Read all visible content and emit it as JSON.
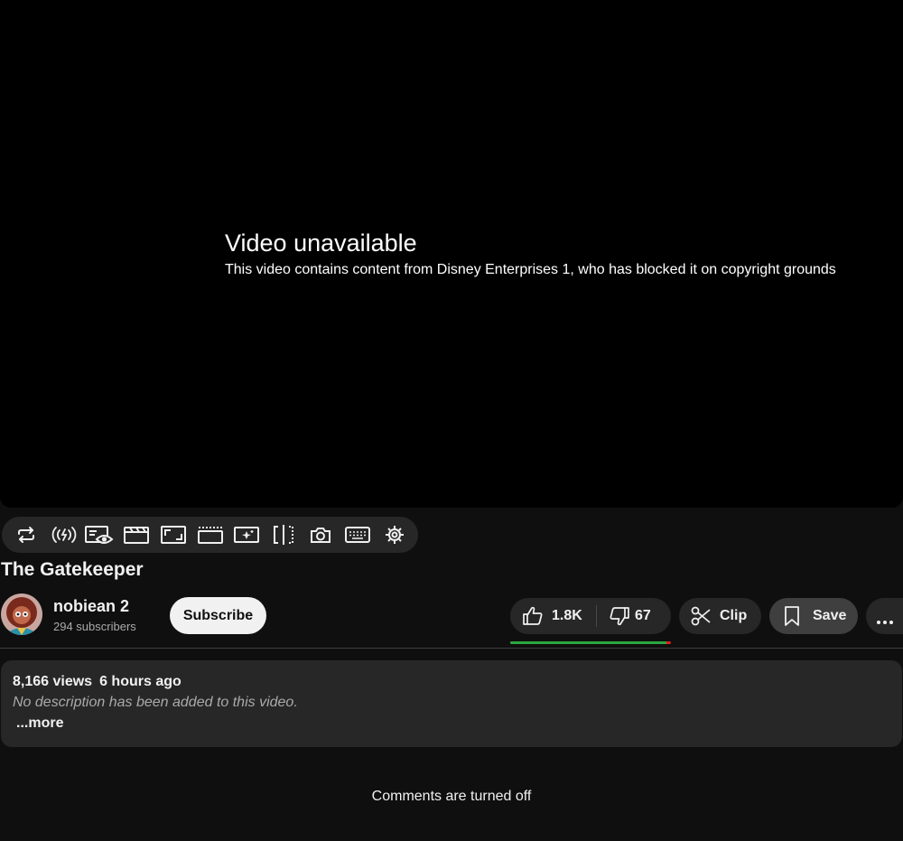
{
  "player": {
    "error_title": "Video unavailable",
    "error_message": "This video contains content from Disney Enterprises 1, who has blocked it on copyright grounds"
  },
  "toolbar": {
    "icons": [
      "loop-icon",
      "broadcast-icon",
      "watch-view-icon",
      "clapperboard-icon",
      "pip-icon",
      "theater-icon",
      "sparkle-screen-icon",
      "split-icon",
      "camera-icon",
      "keyboard-icon",
      "gear-icon"
    ]
  },
  "video": {
    "title": "The Gatekeeper"
  },
  "channel": {
    "name": "nobiean 2",
    "subscribers": "294 subscribers",
    "subscribe_label": "Subscribe"
  },
  "actions": {
    "likes": "1.8K",
    "dislikes": "67",
    "like_ratio": 0.97,
    "clip_label": "Clip",
    "save_label": "Save"
  },
  "description": {
    "views": "8,166 views",
    "time": "6 hours ago",
    "text": "No description has been added to this video.",
    "more_label": "...more"
  },
  "comments": {
    "status": "Comments are turned off"
  },
  "colors": {
    "background": "#0f0f0f",
    "surface": "#272727",
    "like_bar": "#2ba640",
    "dislike_bar": "#e31b1b"
  }
}
